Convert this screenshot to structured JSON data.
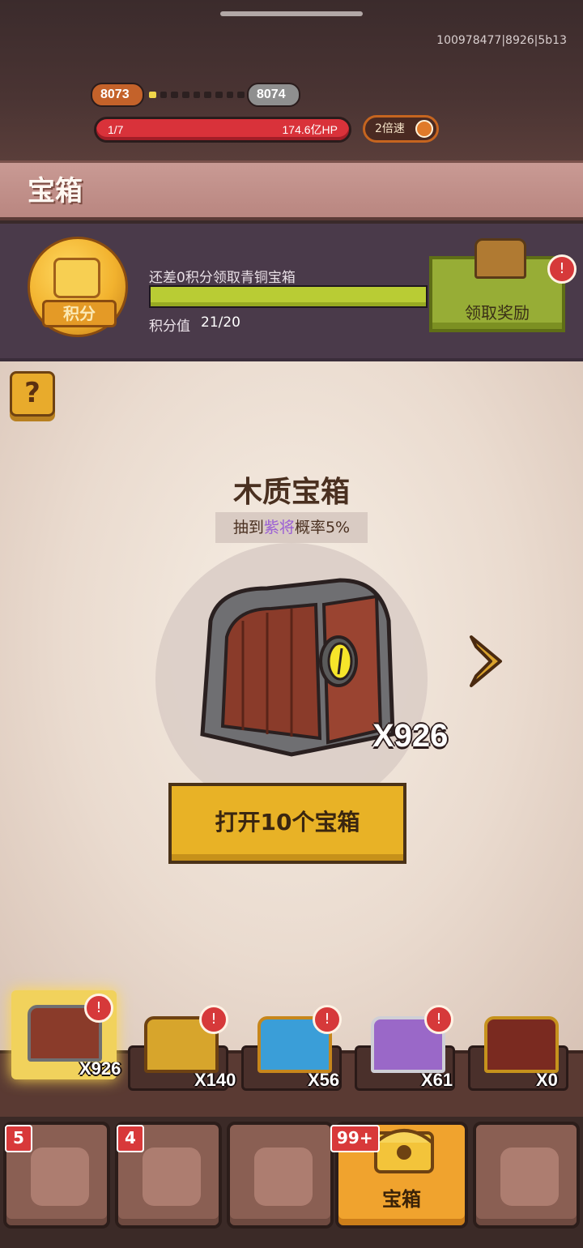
{
  "header": {
    "server_id": "100978477|8926|5b13",
    "level_current": "8073",
    "level_next": "8074",
    "level_progress": 0.1,
    "hp_stage": "1/7",
    "hp_value": "174.6亿HP",
    "speed_label": "2倍速",
    "page_title": "宝箱"
  },
  "points": {
    "medal_label": "积分",
    "hint": "还差0积分领取青铜宝箱",
    "value_label": "积分值",
    "value": "21/20",
    "progress": 1.0,
    "claim_label": "领取奖励",
    "claim_badge": "!"
  },
  "chest": {
    "help_label": "?",
    "name": "木质宝箱",
    "rate_prefix": "抽到",
    "rate_highlight": "紫将",
    "rate_suffix": "概率5%",
    "count": "X926",
    "open_label": "打开10个宝箱"
  },
  "chest_list": [
    {
      "count": "X926",
      "color": "#8a3b2a",
      "badge": "!"
    },
    {
      "count": "X140",
      "color": "#d7a52c",
      "badge": "!"
    },
    {
      "count": "X56",
      "color": "#3a9ed8",
      "badge": "!"
    },
    {
      "count": "X61",
      "color": "#9a68c8",
      "badge": "!"
    },
    {
      "count": "X0",
      "color": "#7a2a20",
      "badge": ""
    }
  ],
  "nav": {
    "tab1_badge": "5",
    "tab2_badge": "4",
    "tab4_badge": "99+",
    "tab4_label": "宝箱"
  }
}
